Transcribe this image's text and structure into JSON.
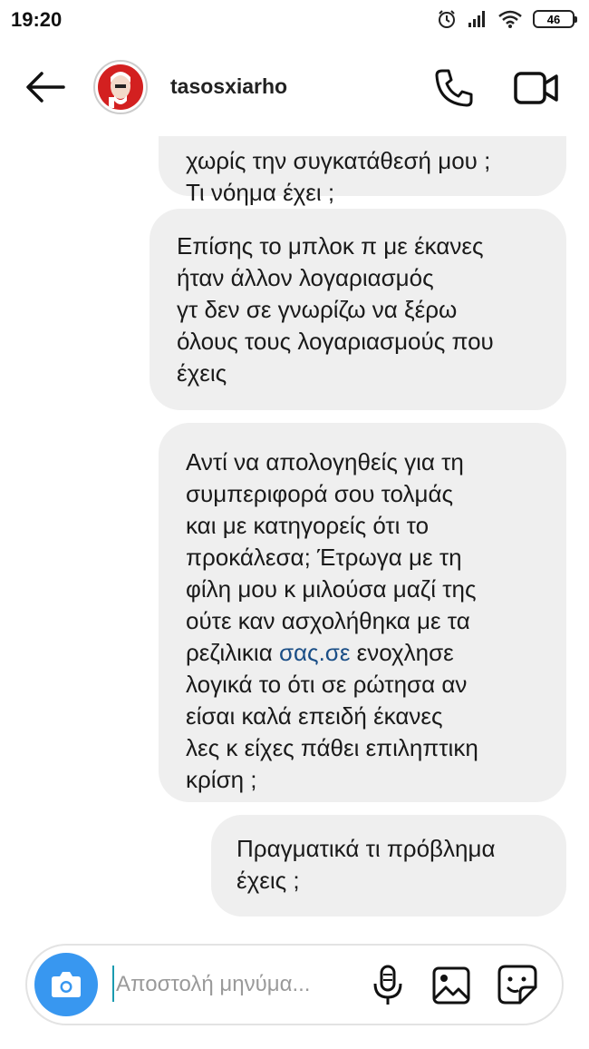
{
  "status_bar": {
    "time": "19:20",
    "battery": "46"
  },
  "header": {
    "username": "tasosxiarho"
  },
  "messages": [
    {
      "lines": [
        "χωρίς την συγκατάθεσή μου ;",
        "Τι νόημα έχει ;"
      ]
    },
    {
      "lines": [
        "Επίσης το μπλοκ π με έκανες",
        "ήταν άλλον λογαριασμός",
        "γτ δεν σε γνωρίζω να ξέρω",
        "όλους τους λογαριασμούς που",
        "έχεις"
      ]
    },
    {
      "lines": [
        "Αντί να απολογηθείς για τη",
        "συμπεριφορά σου τολμάς",
        "και με κατηγορείς ότι το",
        "προκάλεσα; Έτρωγα με τη",
        "φίλη μου κ μιλούσα μαζί της",
        "ούτε καν ασχολήθηκα με τα"
      ],
      "link_line": {
        "before": "ρεζιλικια ",
        "link": "σας.σε",
        "after": " ενοχλησε"
      },
      "lines_after": [
        "λογικά το ότι σε ρώτησα αν",
        "είσαι καλά επειδή έκανες",
        "λες κ είχες πάθει επιληπτικη",
        "κρίση ;"
      ]
    },
    {
      "lines": [
        "Πραγματικά τι πρόβλημα",
        "έχεις ;"
      ]
    }
  ],
  "composer": {
    "placeholder": "Αποστολή μηνύμα..."
  },
  "icons": {
    "back": "arrow-left-icon",
    "call": "phone-icon",
    "video": "video-camera-icon",
    "camera": "camera-icon",
    "mic": "microphone-icon",
    "gallery": "image-icon",
    "sticker": "sticker-icon"
  },
  "colors": {
    "accent": "#3897f0",
    "bubble": "#efefef",
    "link": "#1a4e86",
    "avatar": "#d32020"
  }
}
